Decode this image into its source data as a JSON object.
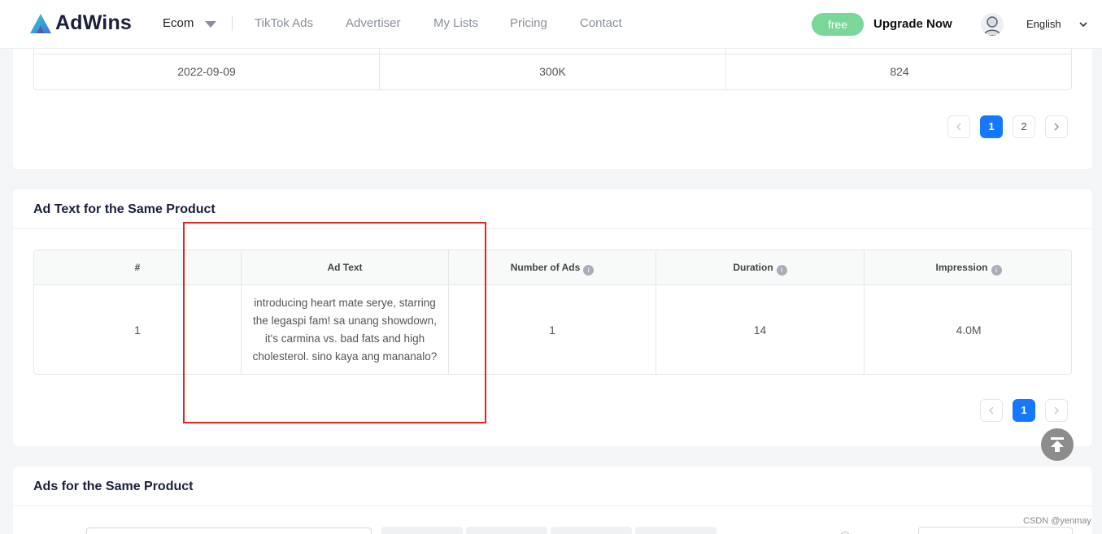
{
  "header": {
    "logo_text": "AdWins",
    "nav_ecom": "Ecom",
    "nav_items": [
      "TikTok Ads",
      "Advertiser",
      "My Lists",
      "Pricing",
      "Contact"
    ],
    "free_badge": "free",
    "upgrade": "Upgrade Now",
    "language": "English"
  },
  "prev_table": {
    "row": [
      "2022-09-09",
      "300K",
      "824"
    ],
    "pagination": {
      "pages": [
        "1",
        "2"
      ],
      "active": "1"
    }
  },
  "ad_text_section": {
    "title": "Ad Text for the Same Product",
    "columns": [
      "#",
      "Ad Text",
      "Number of Ads",
      "Duration",
      "Impression"
    ],
    "info_icon_glyph": "i",
    "rows": [
      {
        "index": "1",
        "ad_text": "introducing heart mate serye, starring the legaspi fam! sa unang showdown, it's carmina vs. bad fats and high cholesterol. sino kaya ang mananalo?",
        "number_of_ads": "1",
        "duration": "14",
        "impression": "4.0M"
      }
    ],
    "pagination": {
      "pages": [
        "1"
      ],
      "active": "1"
    }
  },
  "ads_section": {
    "title": "Ads for the Same Product"
  },
  "watermark": "CSDN @yenmay",
  "colors": {
    "brand_blue": "#1677ff",
    "free_green": "#7ad79a",
    "highlight_red": "#e8231f"
  }
}
